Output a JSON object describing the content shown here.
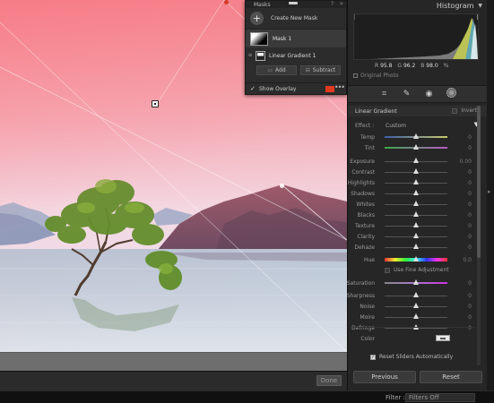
{
  "masks_panel": {
    "title": "Masks",
    "help_icon": "?",
    "collapse_icon": "»",
    "create_label": "Create New Mask",
    "mask_name": "Mask 1",
    "sub_mask_name": "Linear Gradient 1",
    "add_label": "Add",
    "subtract_label": "Subtract",
    "show_overlay_label": "Show Overlay",
    "show_overlay_checked": true,
    "overlay_color": "#e23a1e"
  },
  "histogram": {
    "title": "Histogram",
    "r_label": "R",
    "r_value": "95.8",
    "g_label": "G",
    "g_value": "96.2",
    "b_label": "B",
    "b_value": "98.0",
    "unit": "%",
    "original_photo_label": "Original Photo"
  },
  "linear_gradient": {
    "title": "Linear Gradient",
    "invert_label": "Invert",
    "effect_label": "Effect :",
    "effect_value": "Custom",
    "sliders": [
      {
        "name": "Temp",
        "value": "0",
        "level": 0.5,
        "kind": "temp"
      },
      {
        "name": "Tint",
        "value": "0",
        "level": 0.5,
        "kind": "tint"
      },
      {
        "name": "Exposure",
        "value": "0.00",
        "level": 0.5
      },
      {
        "name": "Contrast",
        "value": "0",
        "level": 0.5
      },
      {
        "name": "Highlights",
        "value": "0",
        "level": 0.5
      },
      {
        "name": "Shadows",
        "value": "0",
        "level": 0.5
      },
      {
        "name": "Whites",
        "value": "0",
        "level": 0.5
      },
      {
        "name": "Blacks",
        "value": "0",
        "level": 0.5
      },
      {
        "name": "Texture",
        "value": "0",
        "level": 0.5
      },
      {
        "name": "Clarity",
        "value": "0",
        "level": 0.5
      },
      {
        "name": "Dehaze",
        "value": "0",
        "level": 0.5
      },
      {
        "name": "Hue",
        "value": "0.0",
        "level": 0.5,
        "kind": "hue"
      },
      {
        "name": "Saturation",
        "value": "0",
        "level": 0.5,
        "kind": "sat"
      },
      {
        "name": "Sharpness",
        "value": "0",
        "level": 0.5
      },
      {
        "name": "Noise",
        "value": "0",
        "level": 0.5
      },
      {
        "name": "Moire",
        "value": "0",
        "level": 0.5
      },
      {
        "name": "Defringe",
        "value": "0",
        "level": 0.5
      }
    ],
    "fine_adjustment_label": "Use Fine Adjustment",
    "color_label": "Color",
    "reset_auto_label": "Reset Sliders Automatically",
    "reset_auto_checked": true
  },
  "footer": {
    "previous_label": "Previous",
    "reset_label": "Reset",
    "done_label": "Done",
    "filter_label": "Filter :",
    "filter_value": "Filters Off"
  }
}
